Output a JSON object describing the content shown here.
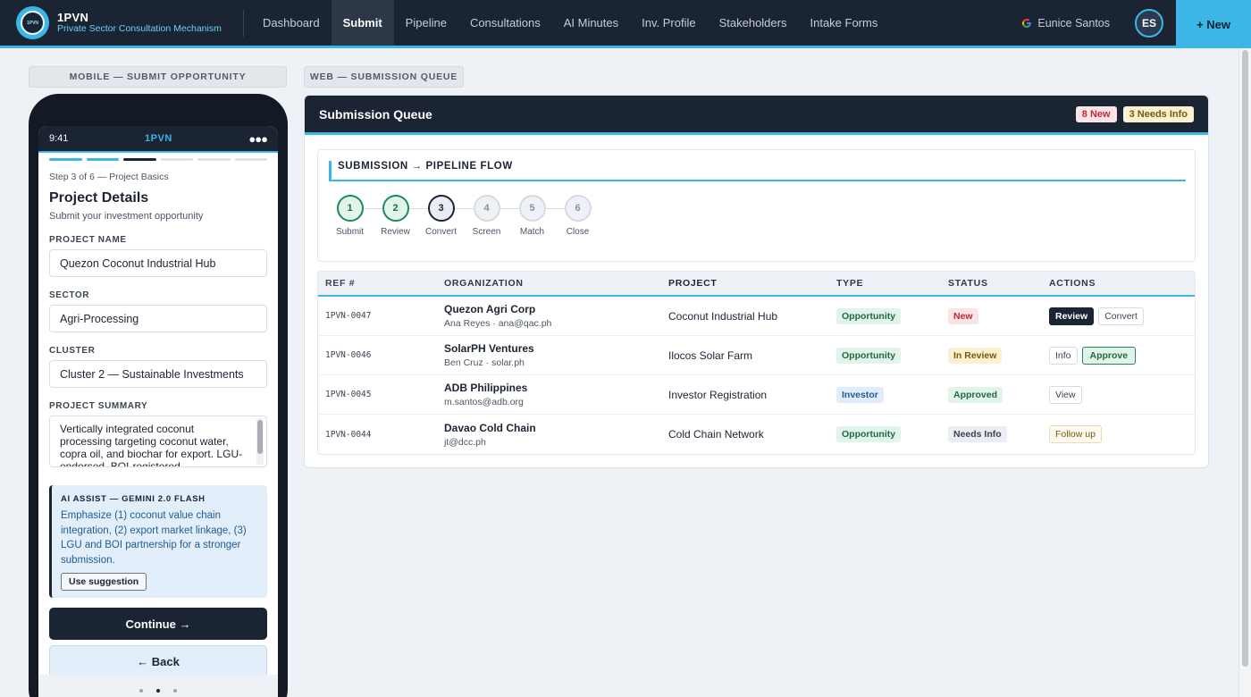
{
  "app": {
    "name": "1PVN",
    "subtitle": "Private Sector Consultation Mechanism",
    "logo_text": "1PVN"
  },
  "nav": [
    {
      "label": "Dashboard",
      "active": false
    },
    {
      "label": "Submit",
      "active": true
    },
    {
      "label": "Pipeline",
      "active": false
    },
    {
      "label": "Consultations",
      "active": false
    },
    {
      "label": "AI Minutes",
      "active": false
    },
    {
      "label": "Inv. Profile",
      "active": false
    },
    {
      "label": "Stakeholders",
      "active": false
    },
    {
      "label": "Intake Forms",
      "active": false
    }
  ],
  "user": {
    "name": "Eunice Santos",
    "initials": "ES"
  },
  "new_button": "+ New",
  "sections": {
    "mobile": "MOBILE — SUBMIT OPPORTUNITY",
    "web": "WEB — SUBMISSION QUEUE"
  },
  "mobile": {
    "time": "9:41",
    "brand": "1PVN",
    "progress": {
      "total": 6,
      "current": 3
    },
    "step_text": "Step 3 of 6 — Project Basics",
    "title": "Project Details",
    "subtitle": "Submit your investment opportunity",
    "fields": {
      "project_name": {
        "label": "PROJECT NAME",
        "value": "Quezon Coconut Industrial Hub"
      },
      "sector": {
        "label": "SECTOR",
        "value": "Agri-Processing"
      },
      "cluster": {
        "label": "CLUSTER",
        "value": "Cluster 2 — Sustainable Investments"
      },
      "summary": {
        "label": "PROJECT SUMMARY",
        "value": "Vertically integrated coconut processing targeting coconut water, copra oil, and biochar for export. LGU-endorsed, BOI-registered."
      }
    },
    "ai": {
      "title": "AI ASSIST — GEMINI 2.0 FLASH",
      "text": "Emphasize (1) coconut value chain integration, (2) export market linkage, (3) LGU and BOI partnership for a stronger submission.",
      "button": "Use suggestion"
    },
    "continue": "Continue →",
    "back": "← Back",
    "page_indicator": {
      "total": 3,
      "current": 2
    }
  },
  "queue": {
    "title": "Submission Queue",
    "badges": {
      "new": "8 New",
      "needs_info": "3 Needs Info"
    },
    "flow_title": "SUBMISSION → PIPELINE FLOW",
    "flow": [
      {
        "num": "1",
        "label": "Submit",
        "state": "done"
      },
      {
        "num": "2",
        "label": "Review",
        "state": "done"
      },
      {
        "num": "3",
        "label": "Convert",
        "state": "current"
      },
      {
        "num": "4",
        "label": "Screen",
        "state": "pending"
      },
      {
        "num": "5",
        "label": "Match",
        "state": "pending"
      },
      {
        "num": "6",
        "label": "Close",
        "state": "pending"
      }
    ],
    "columns": [
      "REF #",
      "ORGANIZATION",
      "PROJECT",
      "TYPE",
      "STATUS",
      "ACTIONS"
    ],
    "rows": [
      {
        "ref": "1PVN-0047",
        "org": "Quezon Agri Corp",
        "contact": "Ana Reyes · ana@qac.ph",
        "project": "Coconut Industrial Hub",
        "type": "Opportunity",
        "status": "New",
        "actions": [
          "Review",
          "Convert"
        ]
      },
      {
        "ref": "1PVN-0046",
        "org": "SolarPH Ventures",
        "contact": "Ben Cruz · solar.ph",
        "project": "Ilocos Solar Farm",
        "type": "Opportunity",
        "status": "In Review",
        "actions": [
          "Info",
          "Approve"
        ]
      },
      {
        "ref": "1PVN-0045",
        "org": "ADB Philippines",
        "contact": "m.santos@adb.org",
        "project": "Investor Registration",
        "type": "Investor",
        "status": "Approved",
        "actions": [
          "View"
        ]
      },
      {
        "ref": "1PVN-0044",
        "org": "Davao Cold Chain",
        "contact": "jt@dcc.ph",
        "project": "Cold Chain Network",
        "type": "Opportunity",
        "status": "Needs Info",
        "actions": [
          "Follow up"
        ]
      }
    ]
  },
  "colors": {
    "accent": "#3cb6e6",
    "navy": "#1b2433",
    "green": "#1e8a5b",
    "red": "#c0283a"
  }
}
